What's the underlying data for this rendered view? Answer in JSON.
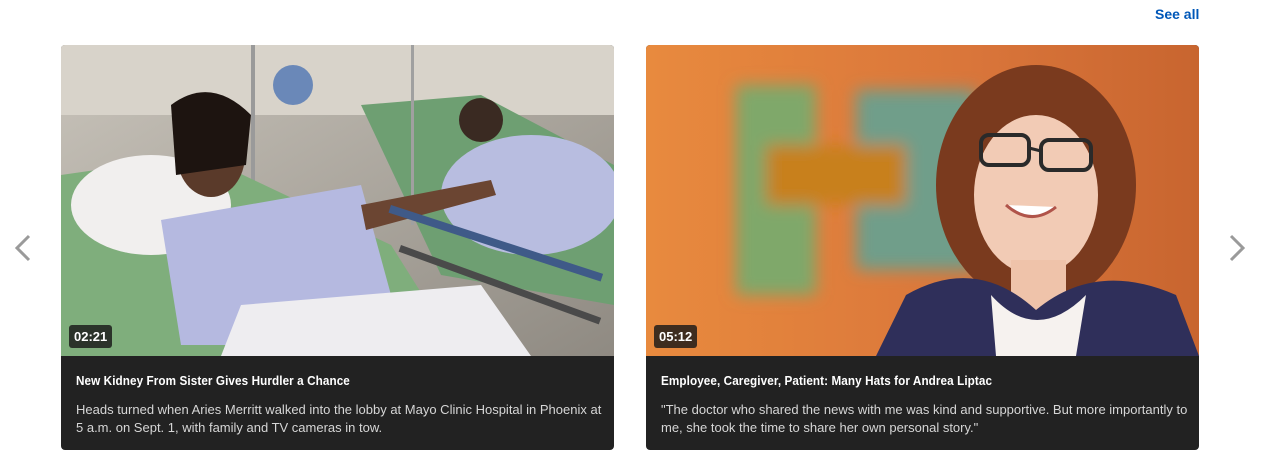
{
  "header": {
    "see_all_label": "See all"
  },
  "carousel": {
    "prev_icon": "chevron-left-icon",
    "next_icon": "chevron-right-icon",
    "cards": [
      {
        "duration": "02:21",
        "title": "New Kidney From Sister Gives Hurdler a Chance",
        "description": "Heads turned when Aries Merritt walked into the lobby at Mayo Clinic Hospital in Phoenix at 5 a.m. on Sept. 1, with family and TV cameras in tow."
      },
      {
        "duration": "05:12",
        "title": "Employee, Caregiver, Patient: Many Hats for Andrea Liptac",
        "description": "\"The doctor who shared the news with me was kind and supportive. But more importantly to me, she took the time to share her own personal story.\""
      }
    ]
  },
  "colors": {
    "link": "#0057b8",
    "card_bg": "#222222",
    "arrow": "#9a9a9a"
  }
}
